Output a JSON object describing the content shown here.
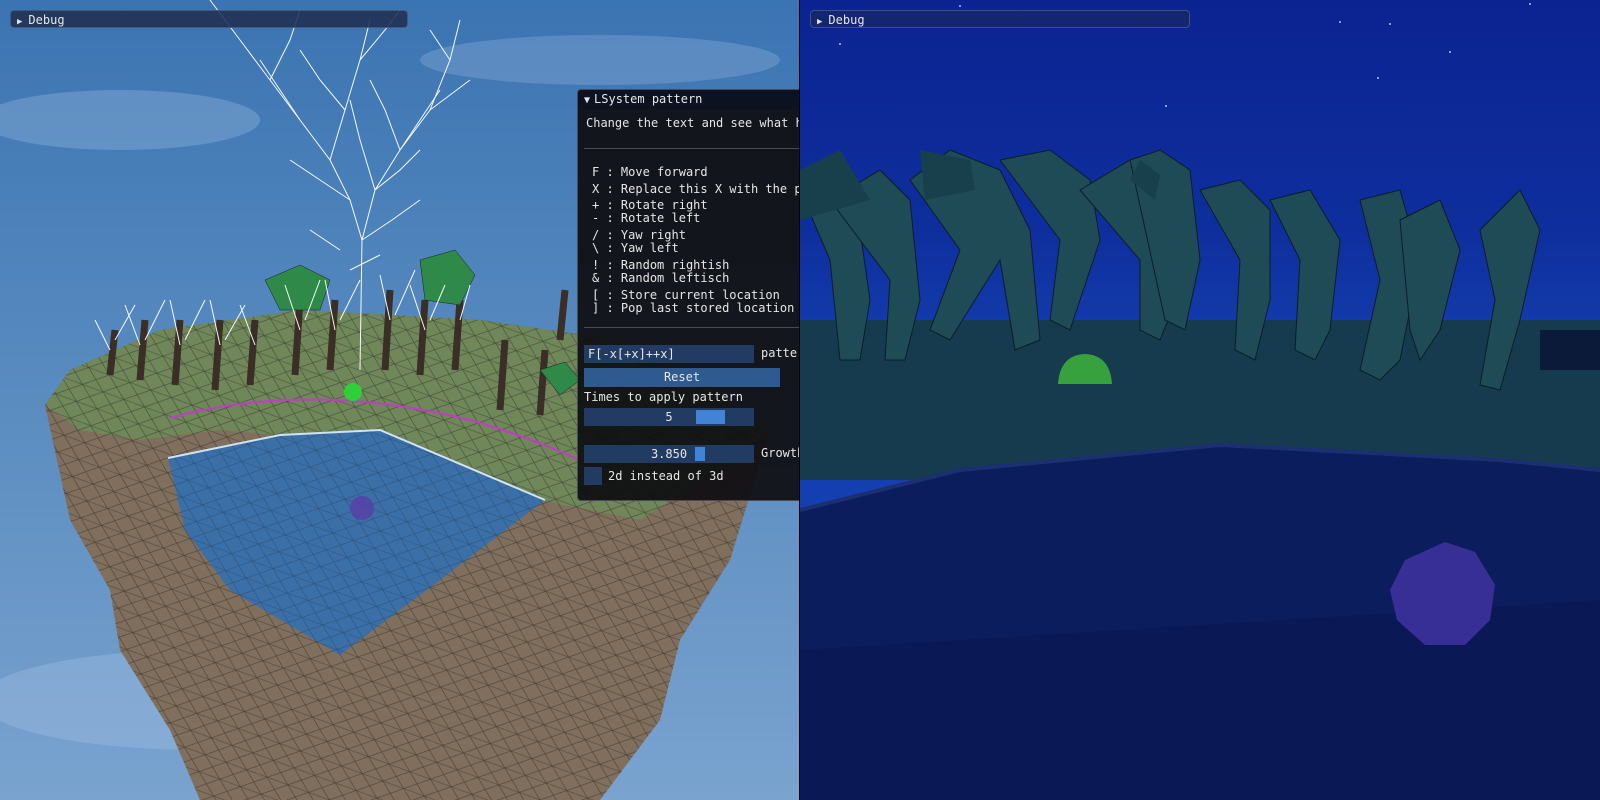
{
  "left_view": {
    "debug_window": {
      "title": "Debug"
    },
    "lsystem_window": {
      "title": "LSystem pattern",
      "intro": "Change the text and see what ha",
      "legend": [
        {
          "key": "F",
          "desc": "Move forward"
        },
        {
          "key": "X",
          "desc": "Replace this X with the pa"
        },
        {
          "key": "+",
          "desc": "Rotate right"
        },
        {
          "key": "-",
          "desc": "Rotate left"
        },
        {
          "key": "/",
          "desc": "Yaw right"
        },
        {
          "key": "\\",
          "desc": "Yaw left"
        },
        {
          "key": "!",
          "desc": "Random rightish"
        },
        {
          "key": "&",
          "desc": "Random leftisch"
        },
        {
          "key": "[",
          "desc": "Store current location"
        },
        {
          "key": "]",
          "desc": "Pop last stored location"
        }
      ],
      "pattern_input": {
        "value": "F[-x[+x]++x]",
        "label": "patter"
      },
      "reset_button": "Reset",
      "times_label": "Times to apply pattern",
      "times_slider": {
        "value": "5",
        "fraction": 0.8
      },
      "growth_slider": {
        "value": "3.850",
        "label": "Growth",
        "fraction": 0.7
      },
      "checkbox_2d": {
        "label": "2d instead of 3d",
        "checked": false
      }
    }
  },
  "right_view": {
    "debug_window": {
      "title": "Debug"
    }
  },
  "colors": {
    "sky_day": "#3f78b4",
    "sky_night": "#0d2590",
    "water_night": "#0b1a57",
    "panel_bg": "#0f0f12",
    "accent": "#4184d6"
  }
}
